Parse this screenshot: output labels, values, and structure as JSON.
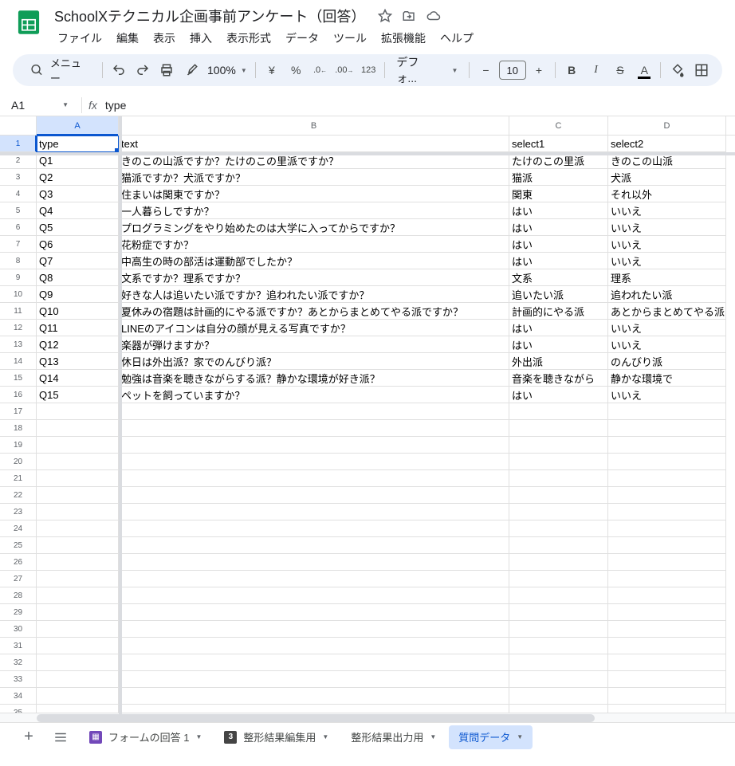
{
  "doc_title": "SchoolXテクニカル企画事前アンケート（回答）",
  "menus": [
    "ファイル",
    "編集",
    "表示",
    "挿入",
    "表示形式",
    "データ",
    "ツール",
    "拡張機能",
    "ヘルプ"
  ],
  "toolbar": {
    "search_label": "メニュー",
    "zoom": "100%",
    "font": "デフォ...",
    "font_size": "10"
  },
  "namebox": "A1",
  "formula": "type",
  "columns": [
    "A",
    "B",
    "C",
    "D"
  ],
  "selected_col": 0,
  "selected_row": 0,
  "rows": [
    [
      "type",
      "text",
      "select1",
      "select2"
    ],
    [
      "Q1",
      "きのこの山派ですか？たけのこの里派ですか？",
      "たけのこの里派",
      "きのこの山派"
    ],
    [
      "Q2",
      "猫派ですか？犬派ですか？",
      "猫派",
      "犬派"
    ],
    [
      "Q3",
      "住まいは関東ですか？",
      "関東",
      "それ以外"
    ],
    [
      "Q4",
      "一人暮らしですか？",
      "はい",
      "いいえ"
    ],
    [
      "Q5",
      "プログラミングをやり始めたのは大学に入ってからですか？",
      "はい",
      "いいえ"
    ],
    [
      "Q6",
      "花粉症ですか？",
      "はい",
      "いいえ"
    ],
    [
      "Q7",
      "中高生の時の部活は運動部でしたか？",
      "はい",
      "いいえ"
    ],
    [
      "Q8",
      "文系ですか？理系ですか？",
      "文系",
      "理系"
    ],
    [
      "Q9",
      "好きな人は追いたい派ですか？追われたい派ですか？",
      "追いたい派",
      "追われたい派"
    ],
    [
      "Q10",
      "夏休みの宿題は計画的にやる派ですか？あとからまとめてやる派ですか？",
      "計画的にやる派",
      "あとからまとめてやる派"
    ],
    [
      "Q11",
      "LINEのアイコンは自分の顔が見える写真ですか？",
      "はい",
      "いいえ"
    ],
    [
      "Q12",
      "楽器が弾けますか？",
      "はい",
      "いいえ"
    ],
    [
      "Q13",
      "休日は外出派？家でのんびり派？",
      "外出派",
      "のんびり派"
    ],
    [
      "Q14",
      "勉強は音楽を聴きながらする派？静かな環境が好き派？",
      "音楽を聴きながら",
      "静かな環境で"
    ],
    [
      "Q15",
      "ペットを飼っていますか？",
      "はい",
      "いいえ"
    ]
  ],
  "total_rows": 36,
  "sheets": [
    {
      "name": "フォームの回答 1",
      "icon": "form",
      "active": false,
      "dd": true
    },
    {
      "name": "整形結果編集用",
      "icon": "badge",
      "badge": "3",
      "active": false,
      "dd": true
    },
    {
      "name": "整形結果出力用",
      "icon": null,
      "active": false,
      "dd": true
    },
    {
      "name": "質問データ",
      "icon": null,
      "active": true,
      "dd": true
    }
  ]
}
